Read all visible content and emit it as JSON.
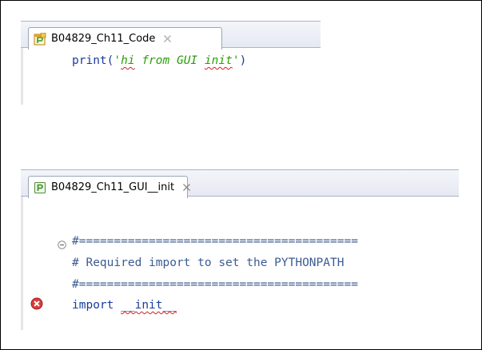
{
  "editors": [
    {
      "tab_title": "B04829_Ch11_Code",
      "lines": [
        {
          "fn": "print",
          "open": "(",
          "str_quote_open": "'",
          "str_word1": "hi",
          "str_mid": " from GUI ",
          "str_word2": "init",
          "str_quote_close": "'",
          "close": ")"
        }
      ]
    },
    {
      "tab_title": "B04829_Ch11_GUI__init",
      "lines": [
        {
          "text": "#========================================"
        },
        {
          "text": "# Required import to set the PYTHONPATH"
        },
        {
          "text": "#========================================"
        },
        {
          "keyword": "import",
          "module": "__init__"
        }
      ]
    }
  ],
  "colors": {
    "code": "#1a3c9c",
    "string": "#2aa00a",
    "error": "#d93b3b",
    "tab_border": "#9aa6b9"
  },
  "icons": {
    "editor1_tab": "python-file-icon",
    "editor2_tab": "python-module-icon",
    "close": "close-icon",
    "fold": "collapse-fold-icon",
    "error": "error-icon"
  }
}
